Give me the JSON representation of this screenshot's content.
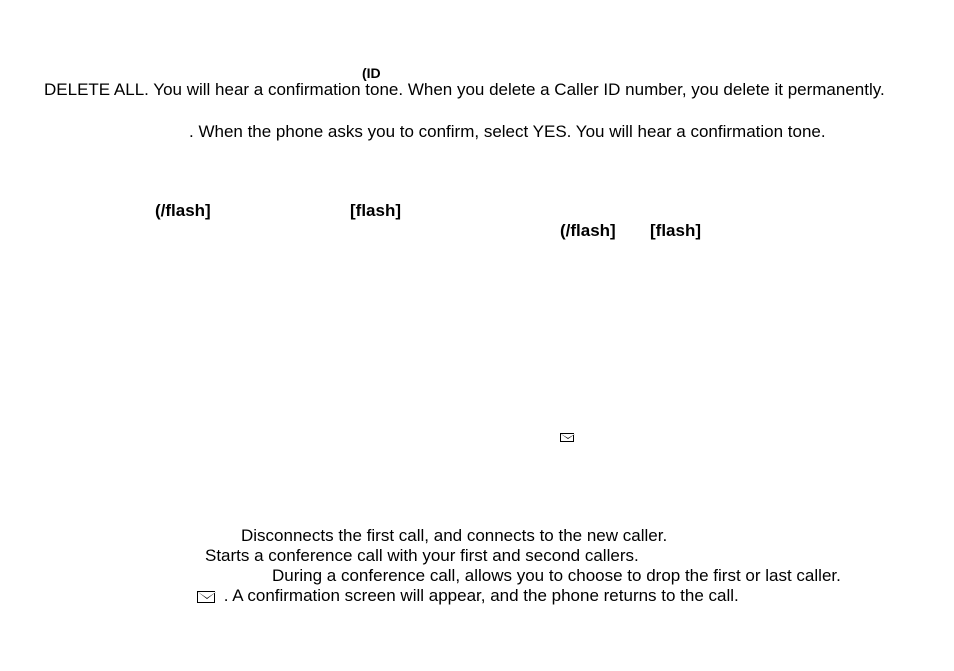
{
  "icon_id": "(ID",
  "line1": "DELETE ALL. You will hear a confirmation tone. When you delete a Caller ID number, you delete it permanently.",
  "line2": ". When the phone asks you to confirm, select YES. You will hear a confirmation tone.",
  "flash1a": "(/flash]",
  "flash1b": "[flash]",
  "flash2a": "(/flash]",
  "flash2b": "[flash]",
  "bullet1": "Disconnects the first call, and connects to the new caller.",
  "bullet2": "Starts a conference call with your first and second callers.",
  "bullet3": "During a conference call, allows you to choose to drop the first or last caller.",
  "bullet4": ". A confirmation screen will appear, and the phone returns to the call."
}
